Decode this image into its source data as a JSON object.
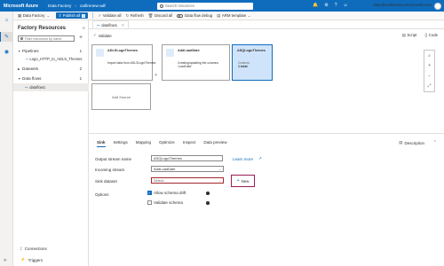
{
  "app": {
    "brand": "Microsoft Azure",
    "breadcrumb": [
      "Data Factory",
      "catfirenew-adf"
    ],
    "search_placeholder": "Search resources",
    "user": "dave@catfirenew.onmicrosoft.com",
    "top_icons": [
      "notifications-icon",
      "settings-icon",
      "help-icon",
      "feedback-icon"
    ]
  },
  "toolbar": {
    "factory_label": "Data Factory",
    "publish_label": "Publish all",
    "publish_count": "1",
    "validate_all": "Validate all",
    "refresh": "Refresh",
    "discard_all": "Discard all",
    "data_flow_debug": "Data flow debug",
    "arm_templates": "ARM template"
  },
  "factory": {
    "title": "Factory Resources",
    "filter_placeholder": "Filter resources by name",
    "pipelines": {
      "label": "Pipelines",
      "count": "1"
    },
    "pipeline_item": "Logo_HTTP_to_ADLS_Themes",
    "datasets": {
      "label": "Datasets",
      "count": "2"
    },
    "dataflows": {
      "label": "Data flows",
      "count": "1"
    },
    "dataflow_item": "dataflow1",
    "connections": "Connections",
    "triggers": "Triggers"
  },
  "editor": {
    "tab_label": "dataflow1",
    "validate": "Validate",
    "script": "Script",
    "code": "Code"
  },
  "nodes": [
    {
      "title": "ADLSLogoThemes",
      "desc": "Import data from ADLSLogoThemes"
    },
    {
      "title": "AddLoadDate",
      "desc": "Creating/updating the columns 'LoadDate'"
    },
    {
      "title": "ASQLogoThemes",
      "mini_label": "Columns:",
      "mini_value": "1 total"
    }
  ],
  "add_source": "Add Source",
  "settings": {
    "tabs": [
      "Sink",
      "Settings",
      "Mapping",
      "Optimize",
      "Inspect",
      "Data preview"
    ],
    "description": "Description",
    "output_stream_label": "Output stream name",
    "output_stream_value": "ASQLogoThemes",
    "incoming_stream_label": "Incoming stream",
    "incoming_stream_value": "AddLoadDate",
    "sink_dataset_label": "Sink dataset",
    "sink_dataset_placeholder": "Select...",
    "learn_more": "Learn more",
    "new_button": "New",
    "options_label": "Options",
    "allow_schema_drift": "Allow schema drift",
    "validate_schema": "Validate schema"
  }
}
